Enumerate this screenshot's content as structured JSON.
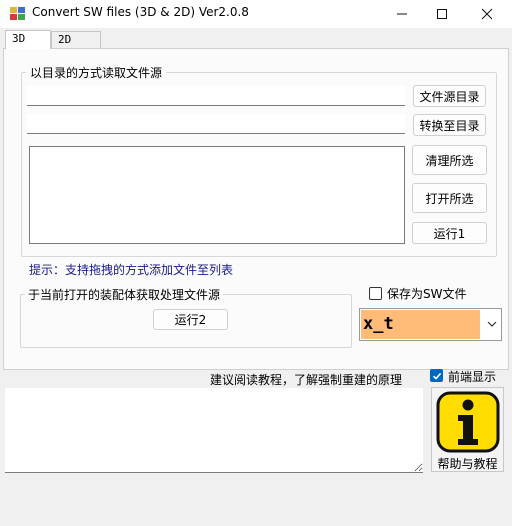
{
  "window": {
    "title": "Convert SW files (3D & 2D) Ver2.0.8",
    "minimize_glyph": "—",
    "maximize_glyph": "☐",
    "close_glyph": "✕"
  },
  "tabs": [
    {
      "label": "3D",
      "active": true
    },
    {
      "label": "2D",
      "active": false
    }
  ],
  "directory_group": {
    "title": "以目录的方式读取文件源",
    "source_dir_value": "",
    "target_dir_value": "",
    "source_dir_button": "文件源目录",
    "target_dir_button": "转换至目录",
    "clear_button": "清理所选",
    "open_button": "打开所选",
    "run_button": "运行1"
  },
  "hint": "提示：支持拖拽的方式添加文件至列表",
  "assembly_group": {
    "title": "于当前打开的装配体获取处理文件源",
    "run_button": "运行2"
  },
  "save_as_sw": {
    "label": "保存为SW文件",
    "checked": false
  },
  "format_select": {
    "value": "x_t",
    "highlight_color": "#ffbb77"
  },
  "tutorial_hint": "建议阅读教程，了解强制重建的原理",
  "frontmost": {
    "label": "前端显示",
    "checked": true
  },
  "log_value": "",
  "help": {
    "label": "帮助与教程",
    "icon": "info-icon",
    "icon_color": "#ffdd00"
  }
}
